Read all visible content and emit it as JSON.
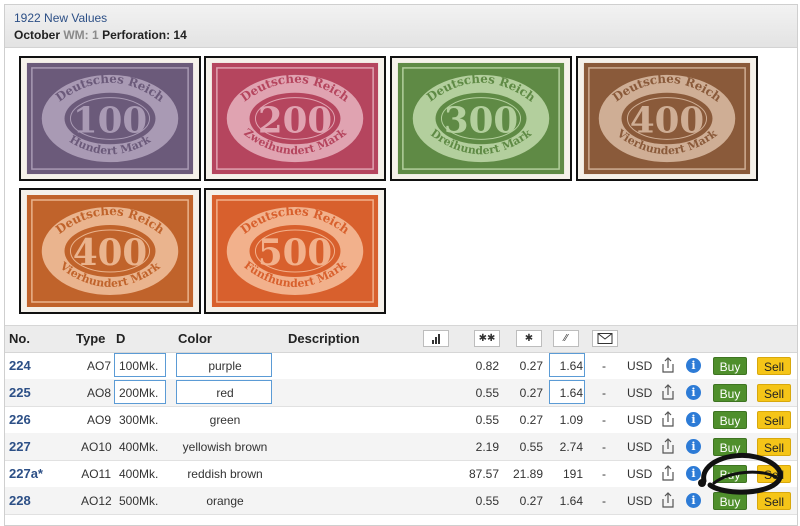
{
  "section": {
    "title": "1922 New Values",
    "month": "October",
    "wm_label": "WM:",
    "wm_value": "1",
    "perf_label": "Perforation:",
    "perf_value": "14"
  },
  "stamps": [
    {
      "value": "100",
      "top": "Deutsches Reich",
      "bottom": "Hundert Mark",
      "color": "#6b5a7a",
      "light": "#a99ab4"
    },
    {
      "value": "200",
      "top": "Deutsches Reich",
      "bottom": "Zweihundert Mark",
      "color": "#b5455e",
      "light": "#e0a3b1"
    },
    {
      "value": "300",
      "top": "Deutsches Reich",
      "bottom": "Dreihundert Mark",
      "color": "#5f8a45",
      "light": "#b3cf9d"
    },
    {
      "value": "400",
      "top": "Deutsches Reich",
      "bottom": "Vierhundert Mark",
      "color": "#8a5a3a",
      "light": "#cfae95"
    },
    {
      "value": "400",
      "top": "Deutsches Reich",
      "bottom": "Vierhundert Mark",
      "color": "#c0632b",
      "light": "#eab48e"
    },
    {
      "value": "500",
      "top": "Deutsches Reich",
      "bottom": "Fünfhundert Mark",
      "color": "#d8602d",
      "light": "#f2b18c"
    }
  ],
  "table": {
    "headers": {
      "no": "No.",
      "type": "Type",
      "d": "D",
      "color": "Color",
      "description": "Description"
    },
    "header_icons": [
      "bar-chart-icon",
      "mint-stars-icon",
      "hinged-star-icon",
      "used-stamp-icon",
      "envelope-icon"
    ],
    "rows": [
      {
        "no": "224",
        "type": "AO7",
        "d": "100Mk.",
        "color": "purple",
        "v1": "0.82",
        "v2": "0.27",
        "v3": "1.64",
        "dash": "-",
        "currency": "USD",
        "buy": "Buy",
        "sell": "Sell"
      },
      {
        "no": "225",
        "type": "AO8",
        "d": "200Mk.",
        "color": "red",
        "v1": "0.55",
        "v2": "0.27",
        "v3": "1.64",
        "dash": "-",
        "currency": "USD",
        "buy": "Buy",
        "sell": "Sell"
      },
      {
        "no": "226",
        "type": "AO9",
        "d": "300Mk.",
        "color": "green",
        "v1": "0.55",
        "v2": "0.27",
        "v3": "1.09",
        "dash": "-",
        "currency": "USD",
        "buy": "Buy",
        "sell": "Sell"
      },
      {
        "no": "227",
        "type": "AO10",
        "d": "400Mk.",
        "color": "yellowish brown",
        "v1": "2.19",
        "v2": "0.55",
        "v3": "2.74",
        "dash": "-",
        "currency": "USD",
        "buy": "Buy",
        "sell": "Sell"
      },
      {
        "no": "227a*",
        "type": "AO11",
        "d": "400Mk.",
        "color": "reddish brown",
        "v1": "87.57",
        "v2": "21.89",
        "v3": "191",
        "dash": "-",
        "currency": "USD",
        "buy": "Buy",
        "sell": "Sell"
      },
      {
        "no": "228",
        "type": "AO12",
        "d": "500Mk.",
        "color": "orange",
        "v1": "0.55",
        "v2": "0.27",
        "v3": "1.64",
        "dash": "-",
        "currency": "USD",
        "buy": "Buy",
        "sell": "Sell"
      }
    ]
  }
}
